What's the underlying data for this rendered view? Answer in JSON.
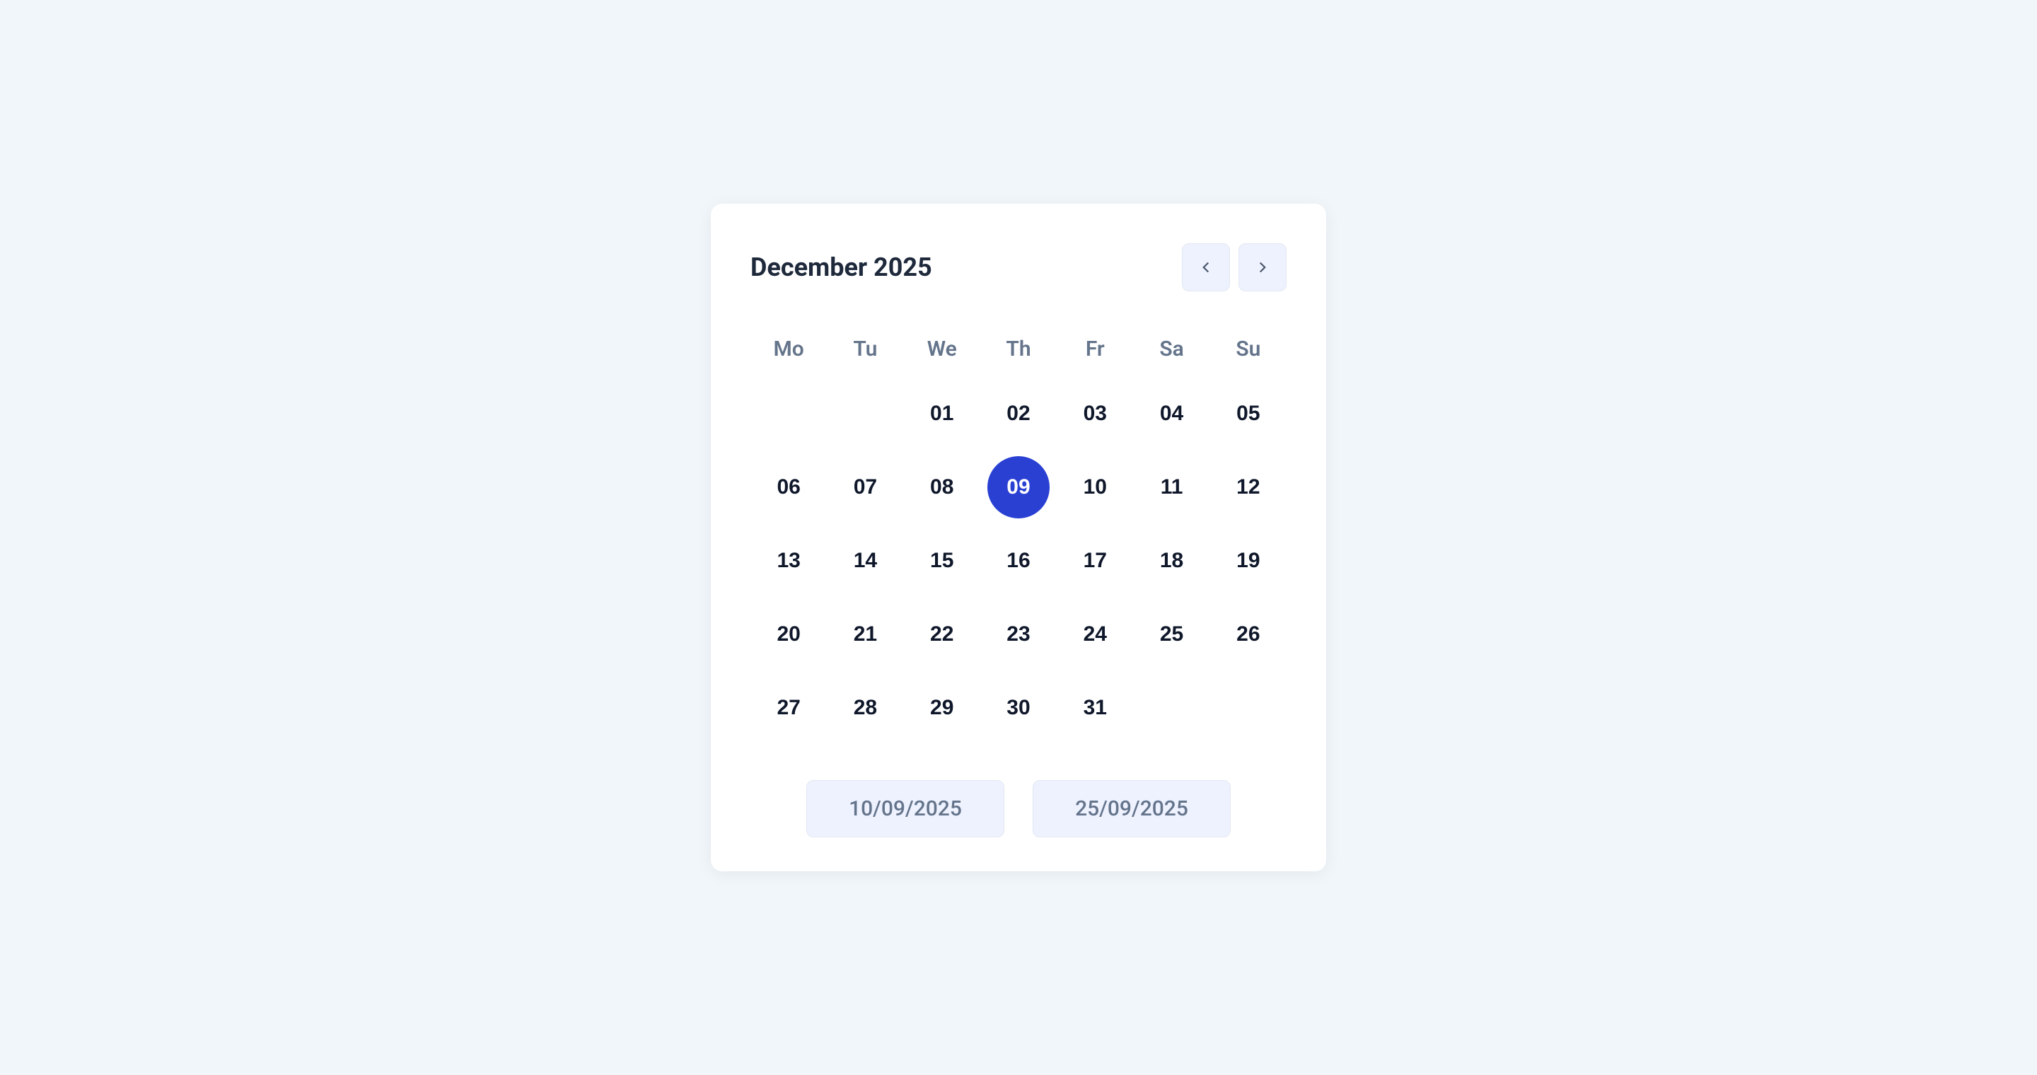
{
  "calendar": {
    "month_year": "December 2025",
    "weekdays": [
      "Mo",
      "Tu",
      "We",
      "Th",
      "Fr",
      "Sa",
      "Su"
    ],
    "leading_blanks": 2,
    "days": [
      "01",
      "02",
      "03",
      "04",
      "05",
      "06",
      "07",
      "08",
      "09",
      "10",
      "11",
      "12",
      "13",
      "14",
      "15",
      "16",
      "17",
      "18",
      "19",
      "20",
      "21",
      "22",
      "23",
      "24",
      "25",
      "26",
      "27",
      "28",
      "29",
      "30",
      "31"
    ],
    "selected_day": "09"
  },
  "footer": {
    "start_date": "10/09/2025",
    "end_date": "25/09/2025"
  }
}
